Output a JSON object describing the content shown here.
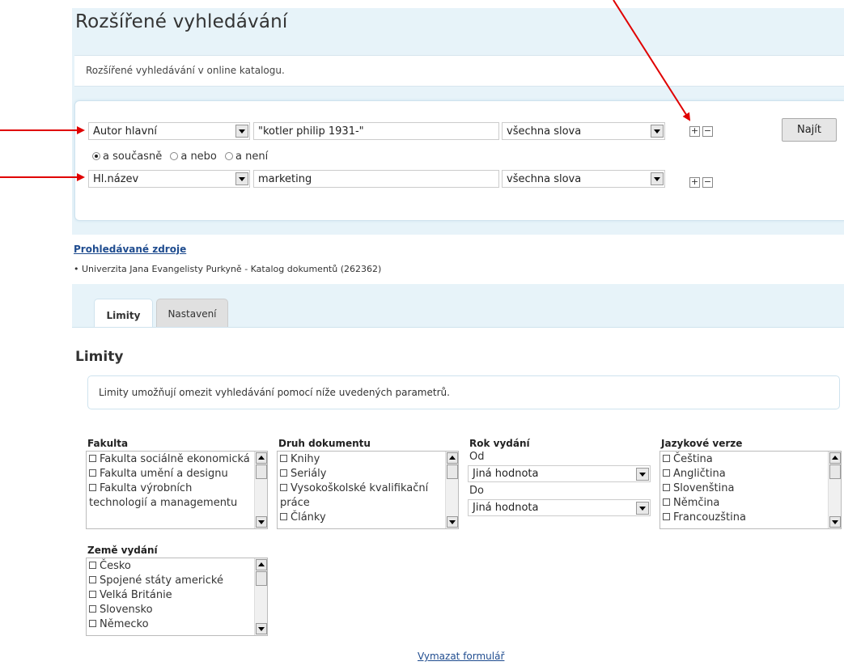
{
  "page": {
    "title": "Rozšířené vyhledávání",
    "intro": "Rozšířené vyhledávání v online katalogu."
  },
  "search": {
    "rows": [
      {
        "field": "Autor hlavní",
        "query": "\"kotler philip 1931-\"",
        "mode": "všechna slova"
      },
      {
        "field": "Hl.název",
        "query": "marketing",
        "mode": "všechna slova"
      }
    ],
    "plus_symbol": "+",
    "minus_symbol": "−",
    "submit_label": "Najít",
    "operators": [
      "a současně",
      "a nebo",
      "a není"
    ],
    "selected_operator": "a současně"
  },
  "sources": {
    "heading": "Prohledávané zdroje",
    "items": [
      "Univerzita Jana Evangelisty Purkyně - Katalog dokumentů (262362)"
    ],
    "bullet": "•"
  },
  "tabs": [
    {
      "label": "Limity",
      "active": true
    },
    {
      "label": "Nastavení",
      "active": false
    }
  ],
  "limits": {
    "title": "Limity",
    "description": "Limity umožňují omezit vyhledávání pomocí níže uvedených parametrů.",
    "faculty": {
      "label": "Fakulta",
      "items": [
        "Fakulta sociálně ekonomická",
        "Fakulta umění a designu",
        "Fakulta výrobních technologií a managementu"
      ]
    },
    "doc_type": {
      "label": "Druh dokumentu",
      "items": [
        "Knihy",
        "Seriály",
        "Vysokoškolské kvalifikační práce",
        "Články"
      ]
    },
    "year": {
      "label": "Rok vydání",
      "from_label": "Od",
      "from_value": "Jiná hodnota",
      "to_label": "Do",
      "to_value": "Jiná hodnota"
    },
    "language": {
      "label": "Jazykové verze",
      "items": [
        "Čeština",
        "Angličtina",
        "Slovenština",
        "Němčina",
        "Francouzština"
      ]
    },
    "country": {
      "label": "Země vydání",
      "items": [
        "Česko",
        "Spojené státy americké",
        "Velká Británie",
        "Slovensko",
        "Německo"
      ]
    }
  },
  "clear_form": "Vymazat formulář",
  "colors": {
    "page_bg": "#e7f3f9",
    "link": "#1f4c8f",
    "annotation_arrow": "#e00000"
  }
}
